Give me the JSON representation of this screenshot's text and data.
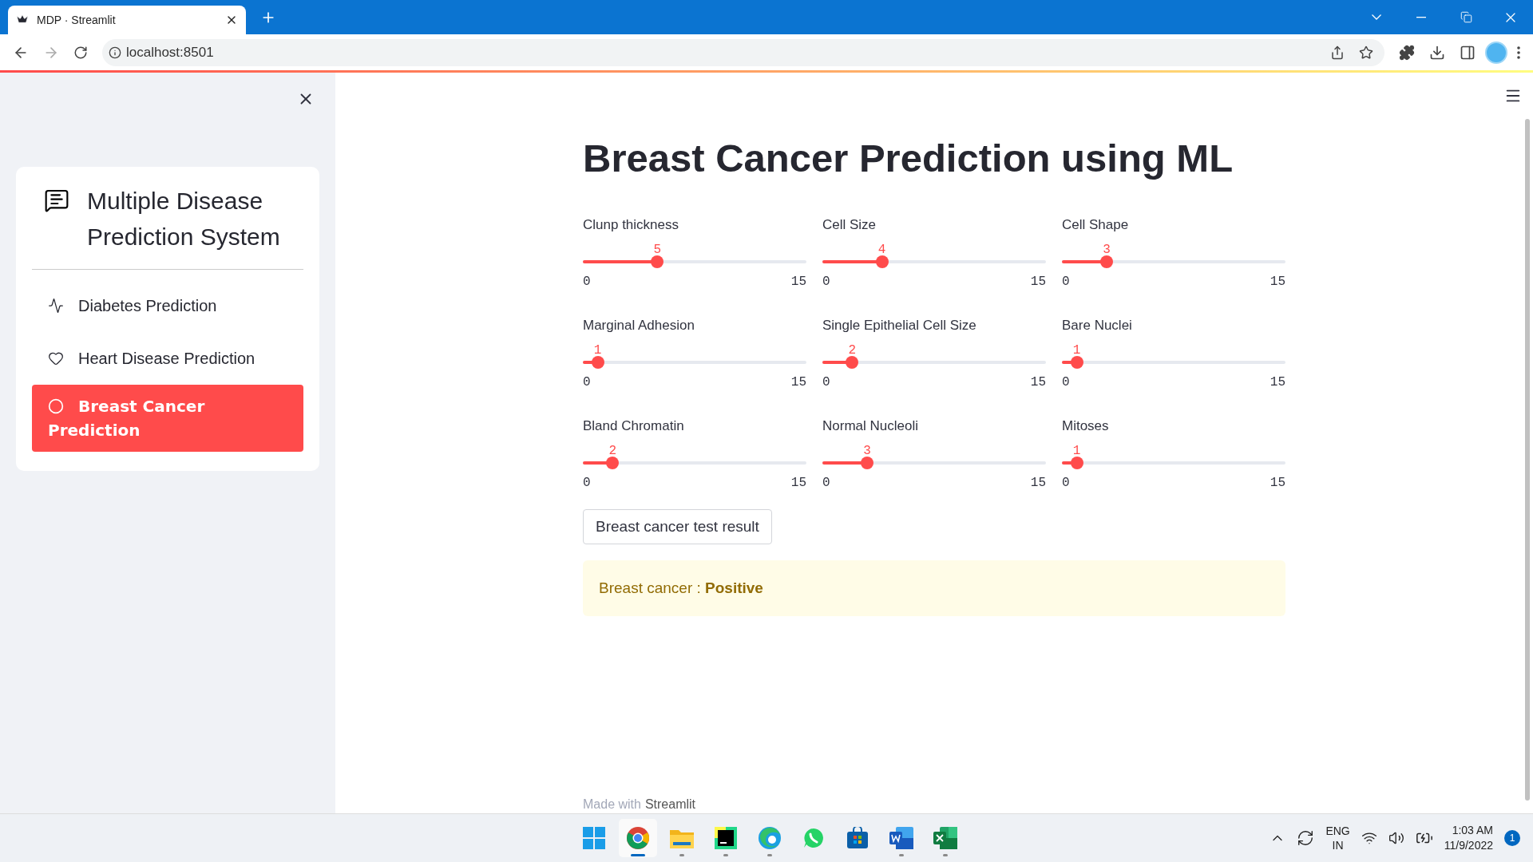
{
  "browser": {
    "tab_title": "MDP · Streamlit",
    "address": "localhost:8501"
  },
  "sidebar": {
    "title": "Multiple Disease Prediction System",
    "items": [
      {
        "label": "Diabetes Prediction",
        "kind": "pulse",
        "selected": false
      },
      {
        "label": "Heart Disease Prediction",
        "kind": "heart",
        "selected": false
      },
      {
        "label": "Breast Cancer Prediction",
        "kind": "circle",
        "selected": true
      }
    ]
  },
  "main": {
    "title": "Breast Cancer Prediction using ML",
    "sliders": [
      {
        "label": "Clunp thickness",
        "value": "5",
        "min": "0",
        "max": "15",
        "level": 0.3333
      },
      {
        "label": "Cell Size",
        "value": "4",
        "min": "0",
        "max": "15",
        "level": 0.2667
      },
      {
        "label": "Cell Shape",
        "value": "3",
        "min": "0",
        "max": "15",
        "level": 0.2
      },
      {
        "label": "Marginal Adhesion",
        "value": "1",
        "min": "0",
        "max": "15",
        "level": 0.0667
      },
      {
        "label": "Single Epithelial Cell Size",
        "value": "2",
        "min": "0",
        "max": "15",
        "level": 0.1333
      },
      {
        "label": "Bare Nuclei",
        "value": "1",
        "min": "0",
        "max": "15",
        "level": 0.0667
      },
      {
        "label": "Bland Chromatin",
        "value": "2",
        "min": "0",
        "max": "15",
        "level": 0.1333
      },
      {
        "label": "Normal Nucleoli",
        "value": "3",
        "min": "0",
        "max": "15",
        "level": 0.2
      },
      {
        "label": "Mitoses",
        "value": "1",
        "min": "0",
        "max": "15",
        "level": 0.0667
      }
    ],
    "button": "Breast cancer test result",
    "result": "Breast cancer : **Positive**",
    "footer_prefix": "Made with",
    "footer_brand": "Streamlit"
  },
  "taskbar": {
    "apps": [
      {
        "kind": "start",
        "running": false,
        "selected": false
      },
      {
        "kind": "chrome",
        "running": true,
        "selected": true
      },
      {
        "kind": "folder",
        "running": true,
        "selected": false
      },
      {
        "kind": "ide",
        "running": true,
        "selected": false
      },
      {
        "kind": "edge",
        "running": true,
        "selected": false
      },
      {
        "kind": "chat",
        "running": false,
        "selected": false
      },
      {
        "kind": "store",
        "running": false,
        "selected": false
      },
      {
        "kind": "word",
        "running": true,
        "selected": false
      },
      {
        "kind": "excel",
        "running": true,
        "selected": false
      }
    ],
    "language": [
      "ENG",
      "IN"
    ],
    "time": "1:03 AM",
    "date": "11/9/2022",
    "notifications": "1"
  }
}
